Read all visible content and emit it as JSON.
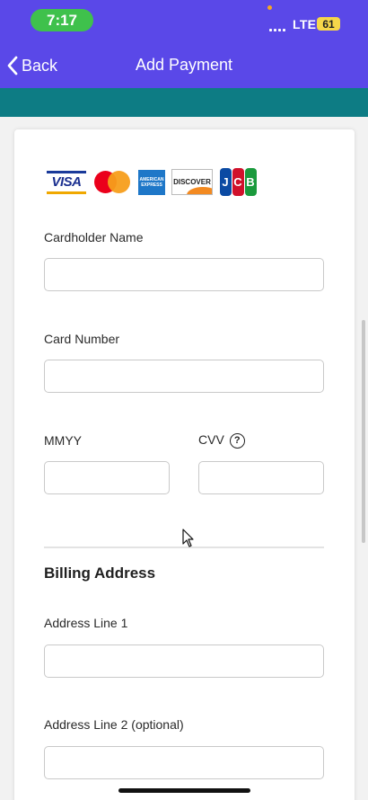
{
  "status_bar": {
    "time": "7:17",
    "network": "LTE",
    "battery": "61"
  },
  "nav": {
    "back_label": "Back",
    "title": "Add Payment"
  },
  "card_brands": {
    "visa": "VISA",
    "discover": "DISCOVER",
    "amex": "AMERICAN EXPRESS",
    "jcb": [
      "J",
      "C",
      "B"
    ]
  },
  "form": {
    "cardholder_name": {
      "label": "Cardholder Name",
      "value": ""
    },
    "card_number": {
      "label": "Card Number",
      "value": ""
    },
    "expiry": {
      "label": "MMYY",
      "value": ""
    },
    "cvv": {
      "label": "CVV",
      "help": "?",
      "value": ""
    },
    "billing_title": "Billing Address",
    "address_line_1": {
      "label": "Address Line 1",
      "value": ""
    },
    "address_line_2": {
      "label": "Address Line 2 (optional)",
      "value": ""
    }
  },
  "colors": {
    "header": "#5a48e8",
    "band": "#0d7c84",
    "time_pill": "#3fc14c",
    "battery": "#f6d64a"
  }
}
